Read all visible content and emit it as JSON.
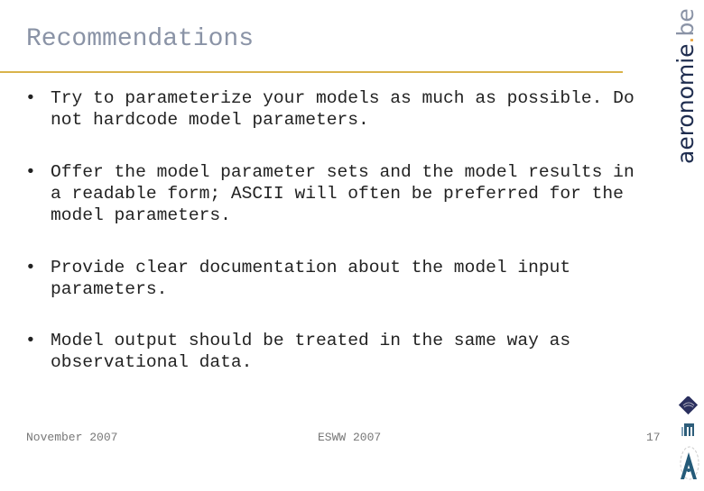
{
  "slide": {
    "title": "Recommendations",
    "logo": {
      "main": "aeronomie",
      "dot": ".",
      "tld": "be"
    },
    "bullets": [
      "Try to parameterize your models as much as possible. Do\nnot hardcode model parameters.",
      "Offer the model parameter sets and the model results in\na readable form; ASCII will often be preferred for the\nmodel parameters.",
      "Provide clear documentation about the model input\nparameters.",
      "Model output should be treated in the same way as\nobservational data."
    ],
    "bullet_glyph": "•",
    "footer": {
      "date": "November 2007",
      "event": "ESWW 2007",
      "page": "17"
    },
    "colors": {
      "title": "#8a93a6",
      "rule": "#d9b34a",
      "logo": "#1f2d4f",
      "logo_dot": "#e8a23a"
    },
    "icons": [
      "institute-diamond-icon",
      "building-icon",
      "astronaut-a-icon"
    ]
  }
}
